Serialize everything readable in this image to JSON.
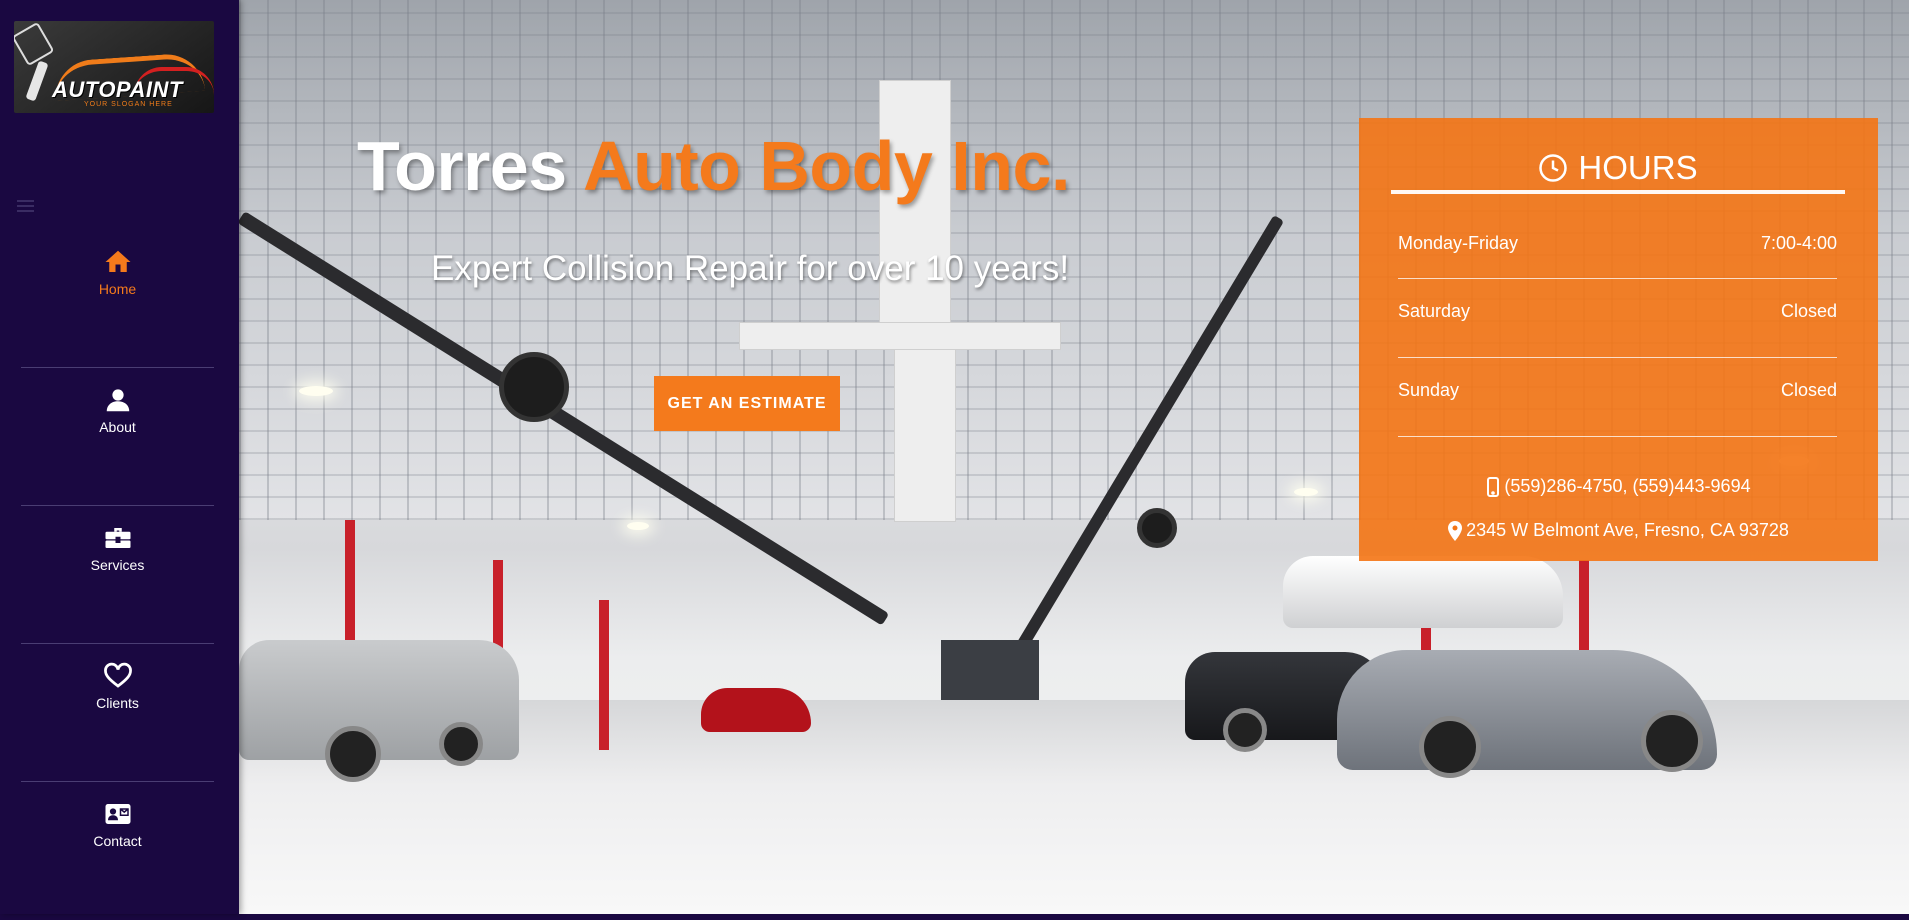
{
  "sidebar": {
    "logo": {
      "brand": "AUTOPAINT",
      "slogan": "YOUR SLOGAN HERE"
    },
    "menu_icon": "hamburger-icon",
    "items": [
      {
        "label": "Home",
        "icon": "home-icon",
        "active": true
      },
      {
        "label": "About",
        "icon": "user-icon",
        "active": false
      },
      {
        "label": "Services",
        "icon": "toolbox-icon",
        "active": false
      },
      {
        "label": "Clients",
        "icon": "heart-icon",
        "active": false
      },
      {
        "label": "Contact",
        "icon": "contact-card-icon",
        "active": false
      }
    ]
  },
  "hero": {
    "title_main": "Torres",
    "title_accent": "Auto Body Inc.",
    "subtitle": "Expert Collision Repair for over 10 years!",
    "cta_label": "GET AN ESTIMATE"
  },
  "hours": {
    "title": "HOURS",
    "rows": [
      {
        "day": "Monday-Friday",
        "time": "7:00-4:00"
      },
      {
        "day": "Saturday",
        "time": "Closed"
      },
      {
        "day": "Sunday",
        "time": "Closed"
      }
    ],
    "phone": "(559)286-4750, (559)443-9694",
    "address": "2345 W Belmont Ave, Fresno, CA 93728"
  },
  "colors": {
    "sidebar_bg": "#1a0841",
    "accent": "#f47a1c",
    "text_light": "#ffffff"
  }
}
